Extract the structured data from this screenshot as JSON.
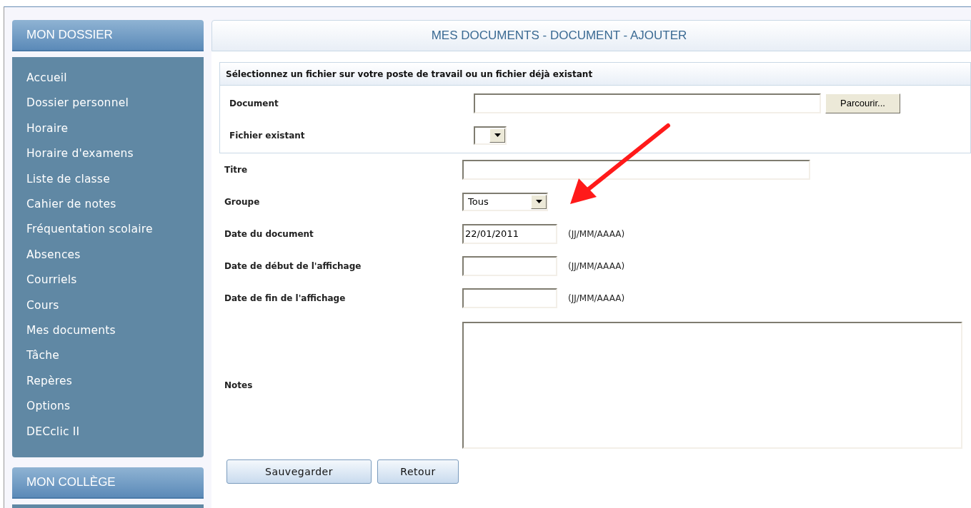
{
  "sidebar": [
    {
      "title": "MON DOSSIER",
      "items": [
        "Accueil",
        "Dossier personnel",
        "Horaire",
        "Horaire d'examens",
        "Liste de classe",
        "Cahier de notes",
        "Fréquentation scolaire",
        "Absences",
        "Courriels",
        "Cours",
        "Mes documents",
        "Tâche",
        "Repères",
        "Options",
        "DECclic II"
      ]
    },
    {
      "title": "MON COLLÈGE"
    }
  ],
  "main": {
    "title": "MES DOCUMENTS - DOCUMENT - AJOUTER",
    "file_section": {
      "heading": "Sélectionnez un fichier sur votre poste de travail ou un fichier déjà existant",
      "fields": [
        {
          "kind": "file",
          "label": "Document",
          "button": "Parcourir..."
        },
        {
          "kind": "select",
          "label": "Fichier existant"
        }
      ]
    },
    "fields": [
      {
        "kind": "text",
        "label": "Titre"
      },
      {
        "kind": "select",
        "label": "Groupe",
        "value": "Tous"
      },
      {
        "kind": "date",
        "label": "Date du document",
        "value": "22/01/2011",
        "hint": "(JJ/MM/AAAA)"
      },
      {
        "kind": "date",
        "label": "Date de début de l'affichage",
        "hint": "(JJ/MM/AAAA)"
      },
      {
        "kind": "date",
        "label": "Date de fin de l'affichage",
        "hint": "(JJ/MM/AAAA)"
      },
      {
        "kind": "textarea",
        "label": "Notes"
      }
    ],
    "buttons": [
      "Sauvegarder",
      "Retour"
    ]
  }
}
